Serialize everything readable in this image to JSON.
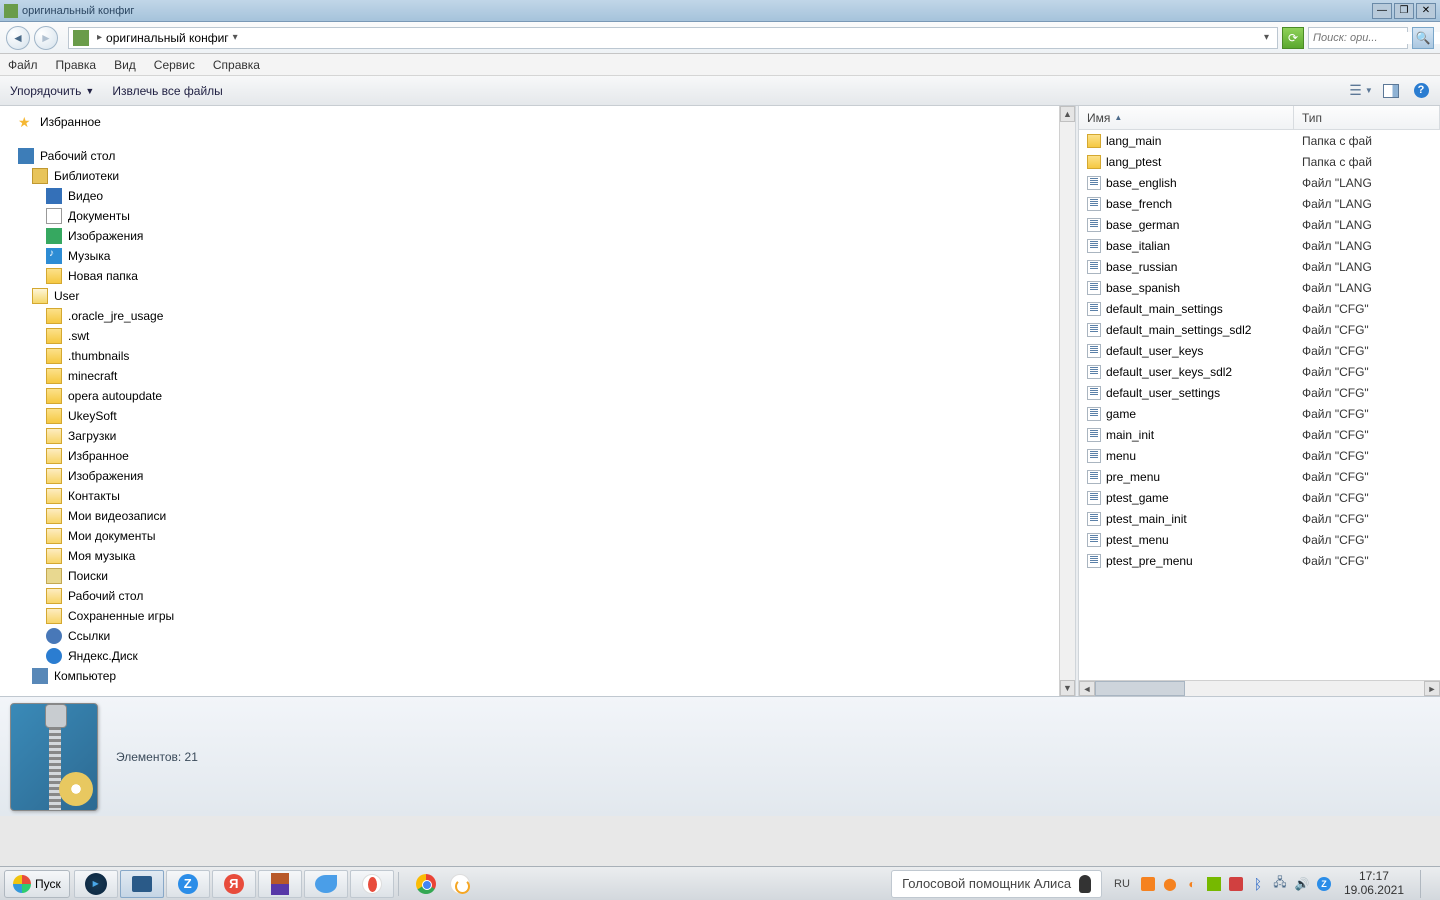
{
  "titlebar": {
    "title": "оригинальный конфиг"
  },
  "nav": {
    "path_label": "оригинальный конфиг",
    "search_placeholder": "Поиск: ори..."
  },
  "menu": {
    "file": "Файл",
    "edit": "Правка",
    "view": "Вид",
    "service": "Сервис",
    "help": "Справка"
  },
  "cmd": {
    "organize": "Упорядочить",
    "extract": "Извлечь все файлы"
  },
  "tree": {
    "favorites": "Избранное",
    "desktop": "Рабочий стол",
    "libraries": "Библиотеки",
    "video": "Видео",
    "documents": "Документы",
    "pictures": "Изображения",
    "music": "Музыка",
    "newfolder": "Новая папка",
    "user": "User",
    "oracle": ".oracle_jre_usage",
    "swt": ".swt",
    "thumbs": ".thumbnails",
    "minecraft": "minecraft",
    "opera": "opera autoupdate",
    "ukey": "UkeySoft",
    "downloads": "Загрузки",
    "fav2": "Избранное",
    "pics2": "Изображения",
    "contacts": "Контакты",
    "myvid": "Мои видеозаписи",
    "mydocs": "Мои документы",
    "mymusic": "Моя музыка",
    "searches": "Поиски",
    "desk2": "Рабочий стол",
    "savedgames": "Сохраненные игры",
    "links": "Ссылки",
    "ydisk": "Яндекс.Диск",
    "computer": "Компьютер"
  },
  "columns": {
    "name": "Имя",
    "type": "Тип"
  },
  "types": {
    "folder": "Папка с фай",
    "lang": "Файл \"LANG",
    "cfg": "Файл \"CFG\""
  },
  "files": [
    {
      "name": "lang_main",
      "kind": "folder"
    },
    {
      "name": "lang_ptest",
      "kind": "folder"
    },
    {
      "name": "base_english",
      "kind": "lang"
    },
    {
      "name": "base_french",
      "kind": "lang"
    },
    {
      "name": "base_german",
      "kind": "lang"
    },
    {
      "name": "base_italian",
      "kind": "lang"
    },
    {
      "name": "base_russian",
      "kind": "lang"
    },
    {
      "name": "base_spanish",
      "kind": "lang"
    },
    {
      "name": "default_main_settings",
      "kind": "cfg"
    },
    {
      "name": "default_main_settings_sdl2",
      "kind": "cfg"
    },
    {
      "name": "default_user_keys",
      "kind": "cfg"
    },
    {
      "name": "default_user_keys_sdl2",
      "kind": "cfg"
    },
    {
      "name": "default_user_settings",
      "kind": "cfg"
    },
    {
      "name": "game",
      "kind": "cfg"
    },
    {
      "name": "main_init",
      "kind": "cfg"
    },
    {
      "name": "menu",
      "kind": "cfg"
    },
    {
      "name": "pre_menu",
      "kind": "cfg"
    },
    {
      "name": "ptest_game",
      "kind": "cfg"
    },
    {
      "name": "ptest_main_init",
      "kind": "cfg"
    },
    {
      "name": "ptest_menu",
      "kind": "cfg"
    },
    {
      "name": "ptest_pre_menu",
      "kind": "cfg"
    }
  ],
  "status": {
    "elements": "Элементов: 21"
  },
  "taskbar": {
    "start": "Пуск",
    "alice": "Голосовой помощник Алиса",
    "lang": "RU",
    "time": "17:17",
    "date": "19.06.2021"
  }
}
